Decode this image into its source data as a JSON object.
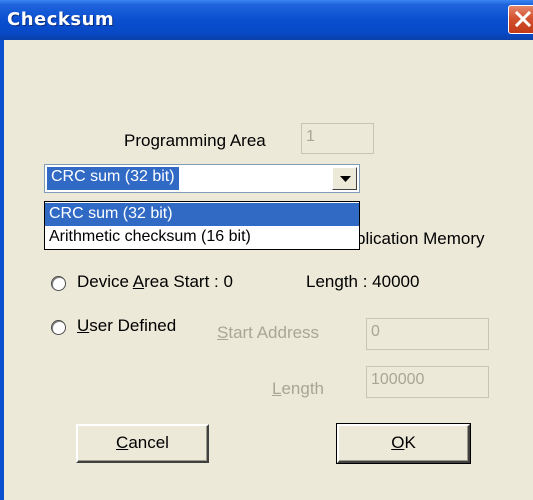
{
  "window": {
    "title": "Checksum"
  },
  "programming_area": {
    "label": "Programming Area",
    "value": "1"
  },
  "checksum_type": {
    "selected": "CRC sum (32 bit)",
    "options": [
      "CRC sum (32 bit)",
      "Arithmetic checksum (16 bit)"
    ]
  },
  "partial_label": "plication Memory",
  "device_area": {
    "label_prefix": "Device ",
    "label_mnemonic": "A",
    "label_suffix": "rea Start : 0",
    "length_text": "Length : 40000"
  },
  "user_defined": {
    "label_mnemonic": "U",
    "label_suffix": "ser Defined",
    "start_label_mnemonic": "S",
    "start_label_suffix": "tart Address",
    "start_value": "0",
    "length_label_mnemonic": "L",
    "length_label_suffix": "ength",
    "length_value": "100000"
  },
  "buttons": {
    "cancel_mnemonic": "C",
    "cancel_suffix": "ancel",
    "ok_mnemonic": "O",
    "ok_suffix": "K"
  }
}
